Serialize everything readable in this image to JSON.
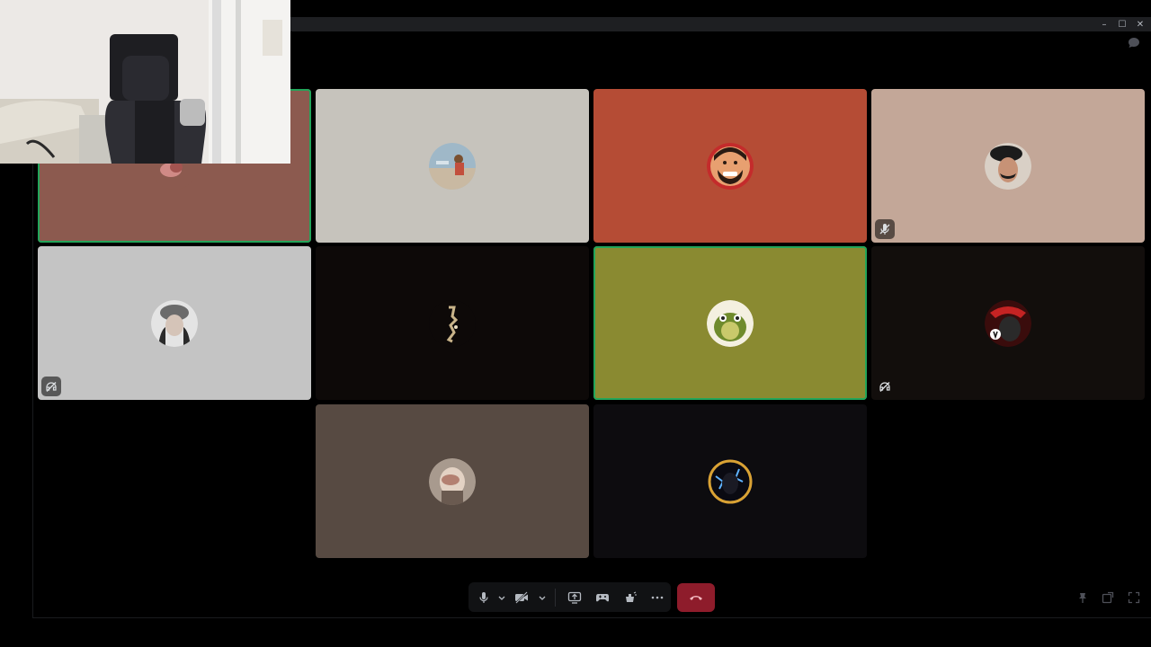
{
  "window": {
    "controls": [
      {
        "name": "minimize",
        "glyph": "–"
      },
      {
        "name": "maximize",
        "glyph": "☐"
      },
      {
        "name": "close",
        "glyph": "✕"
      }
    ]
  },
  "colors": {
    "tile_backgrounds": [
      "#8c5a4f",
      "#c6c3bc",
      "#b54c35",
      "#c3a798",
      "#c4c4c4",
      "#0d0908",
      "#8a8a31",
      "#120e0c",
      "#574a42",
      "#0d0c0f"
    ],
    "speaking_border": "#23a55a",
    "hangup": "#8e1c2b",
    "control_bar": "#111214"
  },
  "participants": [
    {
      "tile": "participant-1",
      "avatar": "avatar-photo",
      "speaking": true,
      "status_icon": null
    },
    {
      "tile": "participant-2",
      "avatar": "avatar-photo",
      "speaking": false,
      "status_icon": null
    },
    {
      "tile": "participant-3",
      "avatar": "avatar-cartoon",
      "speaking": false,
      "status_icon": null
    },
    {
      "tile": "participant-4",
      "avatar": "avatar-photo",
      "speaking": false,
      "status_icon": "mic-muted-icon"
    },
    {
      "tile": "participant-5",
      "avatar": "avatar-photo",
      "speaking": false,
      "status_icon": "deafened-icon"
    },
    {
      "tile": "participant-6",
      "avatar": "avatar-photo",
      "speaking": false,
      "status_icon": null
    },
    {
      "tile": "participant-7",
      "avatar": "avatar-cartoon",
      "speaking": true,
      "status_icon": null
    },
    {
      "tile": "participant-8",
      "avatar": "avatar-photo",
      "speaking": false,
      "status_icon": "deafened-icon"
    },
    {
      "tile": "participant-9",
      "avatar": "avatar-photo",
      "speaking": false,
      "status_icon": null
    },
    {
      "tile": "participant-10",
      "avatar": "avatar-photo",
      "speaking": false,
      "status_icon": null
    }
  ],
  "control_bar": {
    "buttons": [
      "microphone-icon",
      "mic-options-chevron-icon",
      "camera-off-icon",
      "camera-options-chevron-icon",
      "screen-share-icon",
      "activity-icon",
      "soundboard-icon",
      "more-icon"
    ],
    "hangup": "hang-up-icon",
    "right_tools": [
      "pin-icon",
      "popout-icon",
      "fullscreen-icon"
    ]
  }
}
